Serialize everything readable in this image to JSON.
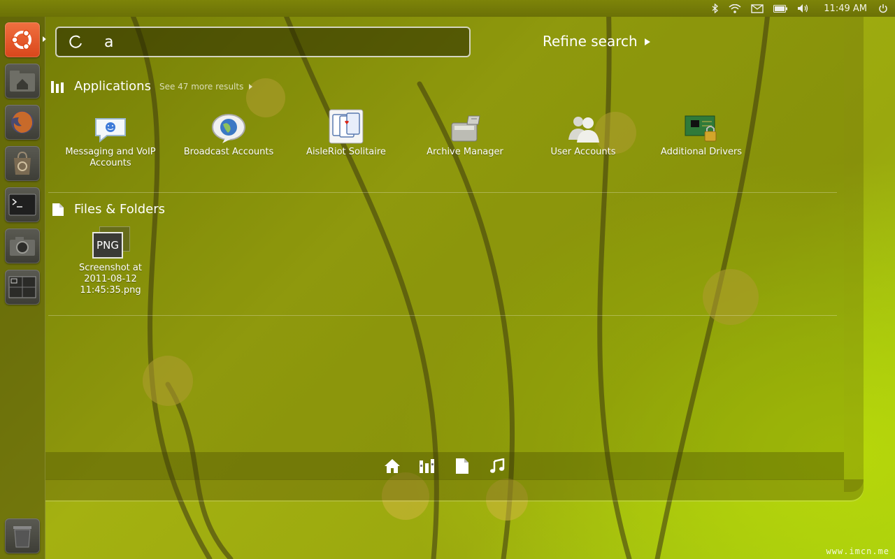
{
  "panel": {
    "clock": "11:49 AM",
    "icons": [
      "bluetooth-icon",
      "wifi-icon",
      "mail-icon",
      "battery-icon",
      "volume-icon",
      "power-icon"
    ]
  },
  "launcher": {
    "items": [
      "ubuntu-logo-icon",
      "home-folder-icon",
      "firefox-icon",
      "software-center-icon",
      "terminal-icon",
      "camera-icon",
      "workspace-switcher-icon",
      "trash-icon"
    ]
  },
  "search": {
    "query": "a",
    "refine_label": "Refine search"
  },
  "applications": {
    "title": "Applications",
    "see_more": "See 47 more results",
    "items": [
      {
        "label": "Messaging and VoIP Accounts",
        "icon": "chat-bubble-icon"
      },
      {
        "label": "Broadcast Accounts",
        "icon": "globe-bubble-icon"
      },
      {
        "label": "AisleRiot Solitaire",
        "icon": "playing-cards-icon"
      },
      {
        "label": "Archive Manager",
        "icon": "archive-icon"
      },
      {
        "label": "User Accounts",
        "icon": "users-icon"
      },
      {
        "label": "Additional Drivers",
        "icon": "circuit-board-lock-icon"
      }
    ]
  },
  "files": {
    "title": "Files & Folders",
    "items": [
      {
        "label": "Screenshot at 2011-08-12 11:45:35.png",
        "badge": "PNG"
      }
    ]
  },
  "filters": [
    "home-icon",
    "applications-icon",
    "files-icon",
    "music-icon"
  ],
  "watermark": "www.imcn.me",
  "colors": {
    "accent": "#dd4814",
    "wallpaper": "#9aa80e"
  }
}
